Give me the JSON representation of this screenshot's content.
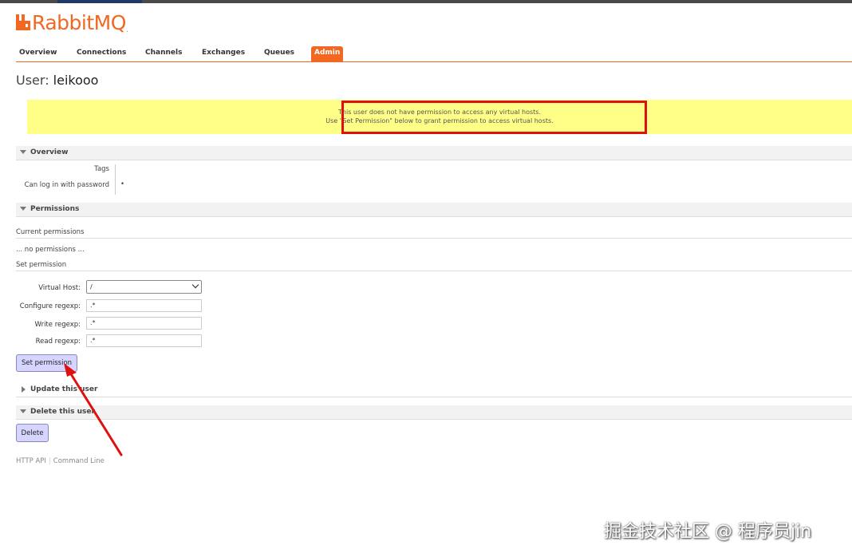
{
  "app": {
    "name_part1": "Rabbit",
    "name_part2": "MQ",
    "tm": "."
  },
  "nav": {
    "tabs": [
      {
        "label": "Overview"
      },
      {
        "label": "Connections"
      },
      {
        "label": "Channels"
      },
      {
        "label": "Exchanges"
      },
      {
        "label": "Queues"
      },
      {
        "label": "Admin"
      }
    ],
    "active": "Admin"
  },
  "page": {
    "title_prefix": "User:",
    "title_user": "leikooo"
  },
  "warning": {
    "line1": "This user does not have permission to access any virtual hosts.",
    "line2": "Use \"Set Permission\" below to grant permission to access virtual hosts."
  },
  "overview": {
    "heading": "Overview",
    "tags_label": "Tags",
    "tags_value": "",
    "login_label": "Can log in with password",
    "login_value": "•"
  },
  "permissions": {
    "heading": "Permissions",
    "current_label": "Current permissions",
    "none_text": "... no permissions ...",
    "set_label": "Set permission",
    "form": {
      "vhost_label": "Virtual Host:",
      "vhost_value": "/",
      "configure_label": "Configure regexp:",
      "configure_value": ".*",
      "write_label": "Write regexp:",
      "write_value": ".*",
      "read_label": "Read regexp:",
      "read_value": ".*"
    },
    "submit_label": "Set permission"
  },
  "update": {
    "heading": "Update this user"
  },
  "delete": {
    "heading": "Delete this user",
    "button_label": "Delete"
  },
  "footer": {
    "http_api": "HTTP API",
    "command_line": "Command Line"
  },
  "watermark": "掘金技术社区 @ 程序员jin",
  "colors": {
    "accent": "#f26822",
    "warning_bg": "#ffff88",
    "annotation": "#e01010",
    "button_bg": "#d5d5ff"
  }
}
